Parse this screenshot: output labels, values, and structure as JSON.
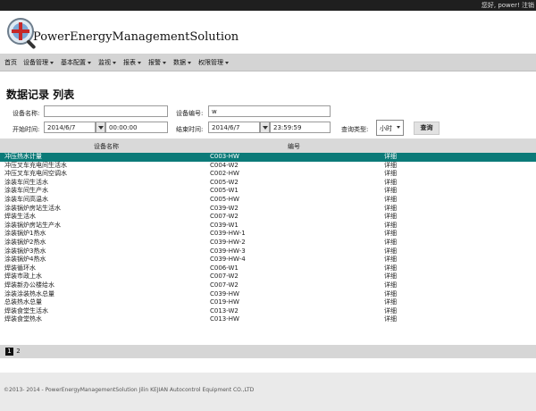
{
  "topbar": {
    "greeting": "您好, power! 注销"
  },
  "header": {
    "brand": "PowerEnergyManagementSolution"
  },
  "nav": {
    "items": [
      {
        "label": "首页",
        "caret": false
      },
      {
        "label": "设备管理",
        "caret": true
      },
      {
        "label": "基本配置",
        "caret": true
      },
      {
        "label": "监视",
        "caret": true
      },
      {
        "label": "报表",
        "caret": true
      },
      {
        "label": "报警",
        "caret": true
      },
      {
        "label": "数据",
        "caret": true
      },
      {
        "label": "权限管理",
        "caret": true
      }
    ]
  },
  "page": {
    "title": "数据记录 列表"
  },
  "filters": {
    "device_name_label": "设备名称:",
    "device_name_value": "",
    "device_code_label": "设备编号:",
    "device_code_value": "w",
    "start_label": "开始时间:",
    "start_date": "2014/6/7",
    "start_time": "00:00:00",
    "end_label": "结束时间:",
    "end_date": "2014/6/7",
    "end_time": "23:59:59",
    "query_type_label": "查询类型:",
    "query_type_value": "小时",
    "query_button": "查询"
  },
  "table": {
    "columns": [
      "设备名称",
      "编号"
    ],
    "rows": [
      {
        "name": "冲压热水计量",
        "code": "C003-HW",
        "action": "详细"
      },
      {
        "name": "冲压叉车充电间生活水",
        "code": "C004-W2",
        "action": "详细"
      },
      {
        "name": "冲压叉车充电间空调水",
        "code": "C002-HW",
        "action": "详细"
      },
      {
        "name": "涂装车间生活水",
        "code": "C005-W2",
        "action": "详细"
      },
      {
        "name": "涂装车间生产水",
        "code": "C005-W1",
        "action": "详细"
      },
      {
        "name": "涂装车间高温水",
        "code": "C005-HW",
        "action": "详细"
      },
      {
        "name": "涂装锅炉房站生活水",
        "code": "C039-W2",
        "action": "详细"
      },
      {
        "name": "焊装生活水",
        "code": "C007-W2",
        "action": "详细"
      },
      {
        "name": "涂装锅炉房站生产水",
        "code": "C039-W1",
        "action": "详细"
      },
      {
        "name": "涂装锅炉1热水",
        "code": "C039-HW-1",
        "action": "详细"
      },
      {
        "name": "涂装锅炉2热水",
        "code": "C039-HW-2",
        "action": "详细"
      },
      {
        "name": "涂装锅炉3热水",
        "code": "C039-HW-3",
        "action": "详细"
      },
      {
        "name": "涂装锅炉4热水",
        "code": "C039-HW-4",
        "action": "详细"
      },
      {
        "name": "焊装循环水",
        "code": "C006-W1",
        "action": "详细"
      },
      {
        "name": "焊装市政上水",
        "code": "C007-W2",
        "action": "详细"
      },
      {
        "name": "焊装新办公楼给水",
        "code": "C007-W2",
        "action": "详细"
      },
      {
        "name": "涂装涂装热水总量",
        "code": "C039-HW",
        "action": "详细"
      },
      {
        "name": "总装热水总量",
        "code": "C019-HW",
        "action": "详细"
      },
      {
        "name": "焊装食堂生活水",
        "code": "C013-W2",
        "action": "详细"
      },
      {
        "name": "焊装食堂热水",
        "code": "C013-HW",
        "action": "详细"
      }
    ]
  },
  "pager": {
    "pages": [
      "1",
      "2"
    ],
    "current": "1"
  },
  "footer": {
    "copyright": "©2013- 2014 - PowerEnergyManagementSolution Jilin KEJIAN Autocontrol Equipment CO.,LTD"
  },
  "colors": {
    "selected_row": "#0b7a78",
    "topbar": "#1f1f1f",
    "nav": "#d4d4d4"
  }
}
